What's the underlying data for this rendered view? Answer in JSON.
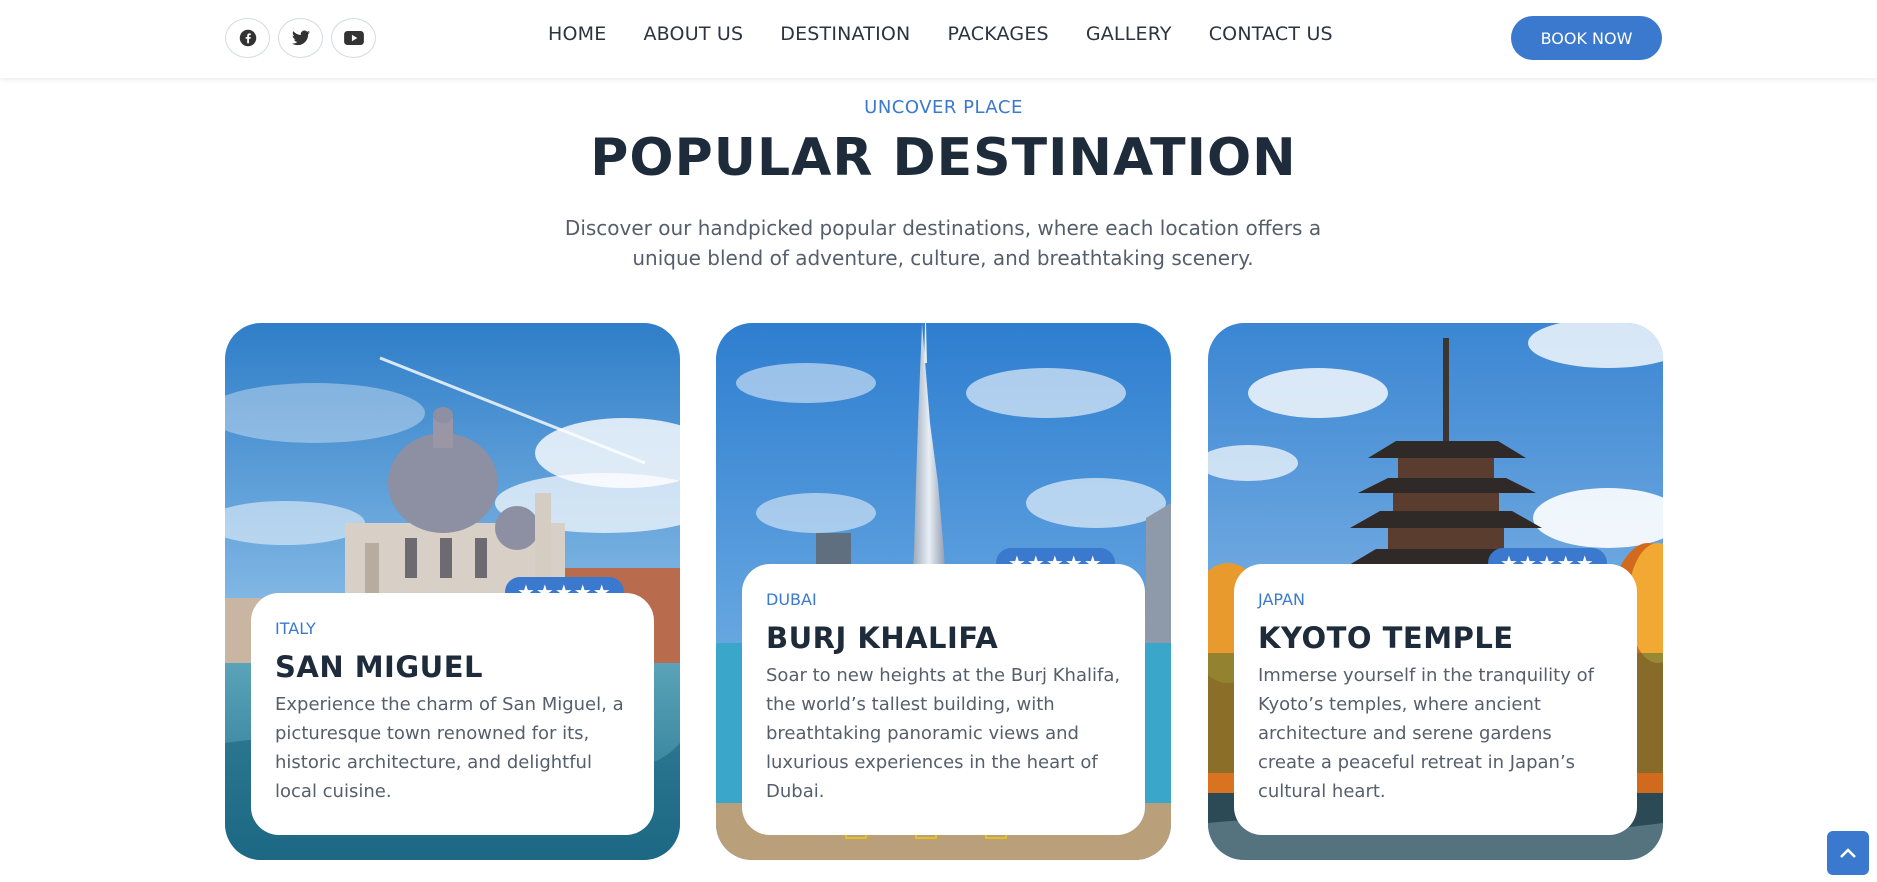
{
  "header": {
    "socials": [
      {
        "icon": "facebook-icon"
      },
      {
        "icon": "twitter-icon"
      },
      {
        "icon": "youtube-icon"
      }
    ],
    "nav": [
      "HOME",
      "ABOUT US",
      "DESTINATION",
      "PACKAGES",
      "GALLERY",
      "CONTACT US"
    ],
    "book_label": "BOOK NOW"
  },
  "section": {
    "eyebrow": "UNCOVER PLACE",
    "title": "POPULAR DESTINATION",
    "subtitle": "Discover our handpicked popular destinations, where each location offers a unique blend of adventure, culture, and breathtaking scenery."
  },
  "cards": [
    {
      "rating": "★★★★★",
      "country": "ITALY",
      "name": "SAN MIGUEL",
      "desc": "Experience the charm of San Miguel, a picturesque town renowned for its, historic architecture, and delightful local cuisine."
    },
    {
      "rating": "★★★★★",
      "country": "DUBAI",
      "name": "BURJ KHALIFA",
      "desc": "Soar to new heights at the Burj Khalifa, the world’s tallest building, with breathtaking panoramic views and luxurious experiences in the heart of Dubai."
    },
    {
      "rating": "★★★★★",
      "country": "JAPAN",
      "name": "KYOTO TEMPLE",
      "desc": "Immerse yourself in the tranquility of Kyoto’s temples, where ancient architecture and serene gardens create a peaceful retreat in Japan’s cultural heart."
    }
  ],
  "colors": {
    "accent": "#3a79cd",
    "heading": "#1e2b3a",
    "body_text": "#555f6b"
  }
}
